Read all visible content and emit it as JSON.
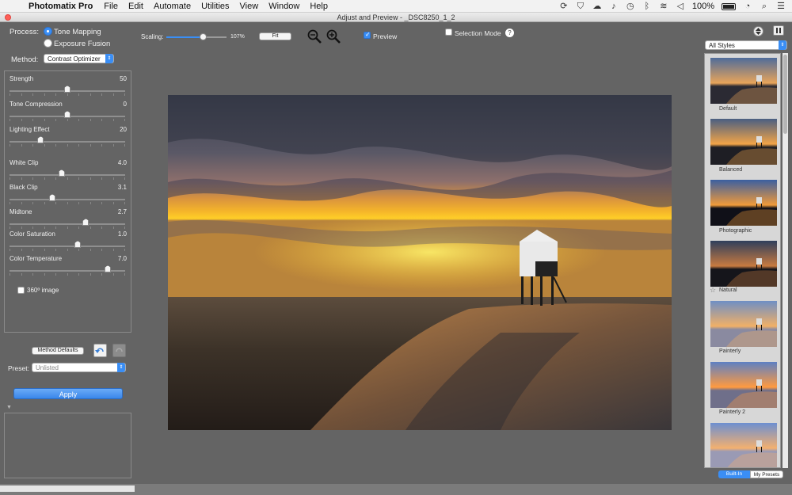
{
  "menubar": {
    "app_name": "Photomatix Pro",
    "menus": [
      "File",
      "Edit",
      "Automate",
      "Utilities",
      "View",
      "Window",
      "Help"
    ],
    "battery": "100%"
  },
  "window": {
    "title": "Adjust and Preview - _DSC8250_1_2"
  },
  "process": {
    "label": "Process:",
    "options": [
      "Tone Mapping",
      "Exposure Fusion"
    ],
    "selected": "Tone Mapping"
  },
  "method": {
    "label": "Method:",
    "value": "Contrast Optimizer"
  },
  "sliders": [
    {
      "name": "Strength",
      "value": "50",
      "pos": 0.5
    },
    {
      "name": "Tone Compression",
      "value": "0",
      "pos": 0.5
    },
    {
      "name": "Lighting Effect",
      "value": "20",
      "pos": 0.27
    },
    {
      "name": "White Clip",
      "value": "4.0",
      "pos": 0.45
    },
    {
      "name": "Black Clip",
      "value": "3.1",
      "pos": 0.37
    },
    {
      "name": "Midtone",
      "value": "2.7",
      "pos": 0.66
    },
    {
      "name": "Color Saturation",
      "value": "1.0",
      "pos": 0.59
    },
    {
      "name": "Color Temperature",
      "value": "7.0",
      "pos": 0.85
    }
  ],
  "image360": {
    "label": "360º image",
    "checked": false
  },
  "method_defaults_label": "Method Defaults",
  "preset": {
    "label": "Preset:",
    "value": "Unlisted"
  },
  "apply_label": "Apply",
  "toolbar": {
    "scaling_label": "Scaling:",
    "scaling_value": "107%",
    "scaling_pos": 0.6,
    "fit_label": "Fit",
    "preview_label": "Preview",
    "preview_checked": true,
    "selection_mode_label": "Selection Mode",
    "selection_checked": false,
    "help_label": "?"
  },
  "styles": {
    "filter": "All Styles",
    "presets": [
      "Default",
      "Balanced",
      "Photographic",
      "Natural",
      "Painterly",
      "Painterly 2"
    ],
    "tabs": [
      "Built-In",
      "My Presets"
    ],
    "active_tab": "Built-In"
  },
  "colors": {
    "accent": "#3a8ef5",
    "panel_bg": "#646464",
    "styles_bg": "#d7d7d7"
  },
  "icons": {
    "apple": "apple-icon",
    "zoom_out": "zoom-out-icon",
    "zoom_in": "zoom-in-icon",
    "undo": "undo-icon",
    "redo": "redo-icon",
    "sort": "sort-icon",
    "grid": "grid-icon",
    "star": "star-icon"
  }
}
